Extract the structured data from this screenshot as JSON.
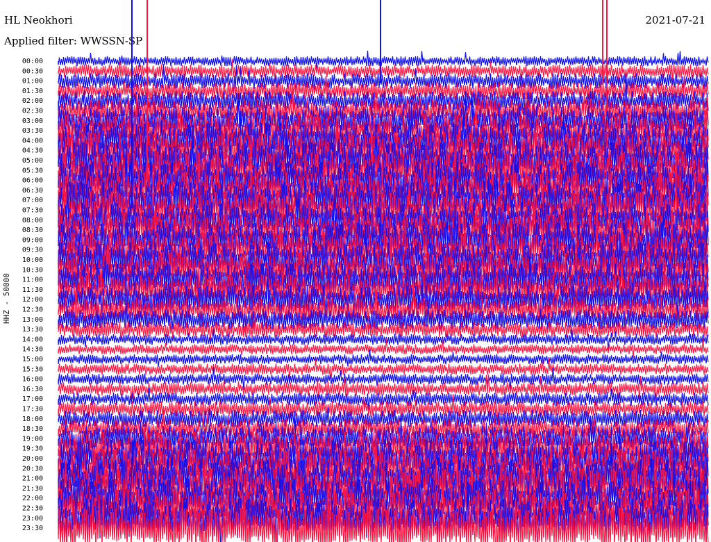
{
  "header": {
    "station": "HL Neokhori",
    "date": "2021-07-21",
    "filter": "Applied filter: WWSSN-SP"
  },
  "chart_data": {
    "type": "line",
    "ylabel": "HHZ - 50000",
    "trace_colors": [
      "#1010ee",
      "#ff1744"
    ],
    "rows": [
      "00:00",
      "00:30",
      "01:00",
      "01:30",
      "02:00",
      "02:30",
      "03:00",
      "03:30",
      "04:00",
      "04:30",
      "05:00",
      "05:30",
      "06:00",
      "06:30",
      "07:00",
      "07:30",
      "08:00",
      "08:30",
      "09:00",
      "09:30",
      "10:00",
      "10:30",
      "11:00",
      "11:30",
      "12:00",
      "12:30",
      "13:00",
      "13:30",
      "14:00",
      "14:30",
      "15:00",
      "15:30",
      "16:00",
      "16:30",
      "17:00",
      "17:30",
      "18:00",
      "18:30",
      "19:00",
      "19:30",
      "20:00",
      "20:30",
      "21:00",
      "21:30",
      "22:00",
      "22:30",
      "23:00",
      "23:30"
    ],
    "row_amplitude": [
      0.45,
      0.6,
      0.7,
      0.8,
      0.9,
      1.1,
      1.3,
      1.5,
      1.6,
      1.7,
      1.7,
      1.7,
      1.7,
      1.7,
      1.7,
      1.7,
      1.6,
      1.6,
      1.6,
      1.6,
      1.6,
      1.6,
      1.5,
      1.4,
      1.3,
      1.1,
      0.9,
      0.7,
      0.5,
      0.45,
      0.45,
      0.5,
      0.5,
      0.6,
      0.6,
      0.7,
      0.8,
      0.9,
      1.2,
      1.5,
      1.7,
      1.8,
      1.8,
      1.8,
      1.8,
      1.8,
      1.8,
      1.9
    ]
  }
}
